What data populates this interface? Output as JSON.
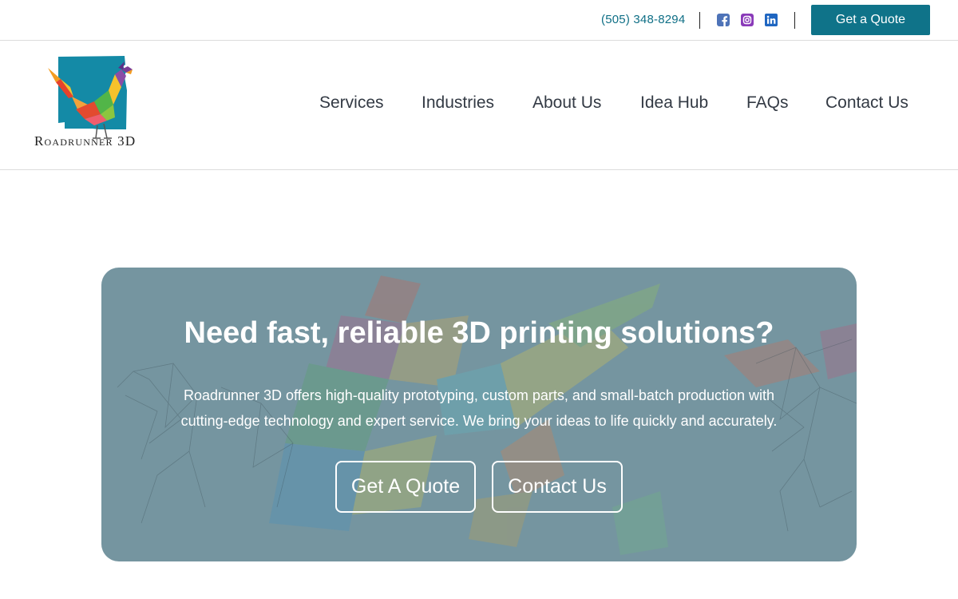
{
  "topbar": {
    "phone": "(505) 348-8294",
    "social": [
      {
        "icon": "facebook-icon",
        "color": "#4e73b8"
      },
      {
        "icon": "instagram-icon",
        "color": "#8a3ab9"
      },
      {
        "icon": "linkedin-icon",
        "color": "#1f66c1"
      }
    ],
    "quote_label": "Get a Quote",
    "accent": "#0f7389"
  },
  "header": {
    "logo_text": "Roadrunner 3D",
    "nav": [
      "Services",
      "Industries",
      "About Us",
      "Idea Hub",
      "FAQs",
      "Contact Us"
    ]
  },
  "hero": {
    "title": "Need fast, reliable 3D printing solutions?",
    "line1": "Roadrunner 3D offers high-quality prototyping, custom parts, and small-batch production with",
    "line2": "cutting-edge technology and expert service. We bring your ideas to life quickly and accurately.",
    "primary_button": "Get A Quote",
    "secondary_button": "Contact Us",
    "overlay_color": "#7595a0"
  }
}
